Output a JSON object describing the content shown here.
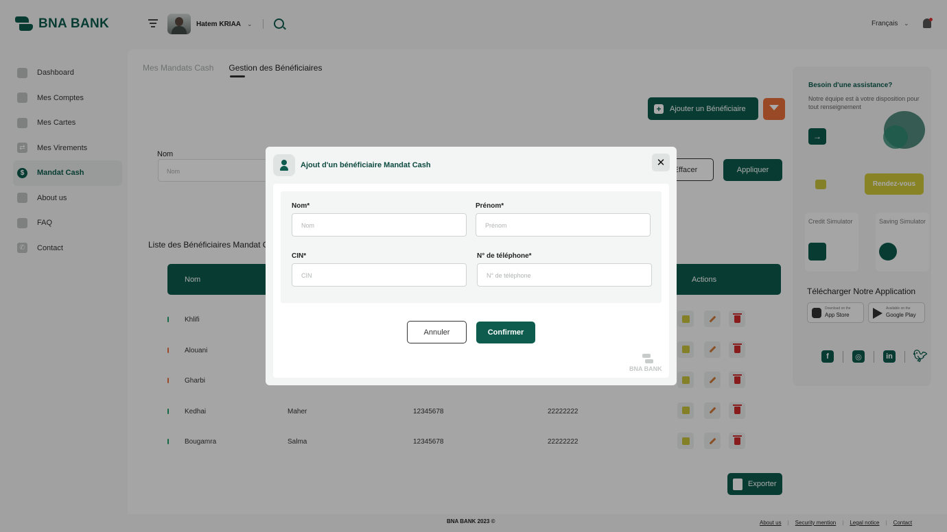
{
  "brand": {
    "name": "BNA BANK",
    "color": "#0d5c4e"
  },
  "sidebar": {
    "items": [
      {
        "label": "Dashboard",
        "icon": "dashboard-icon"
      },
      {
        "label": "Mes Comptes",
        "icon": "folder-icon"
      },
      {
        "label": "Mes Cartes",
        "icon": "card-icon"
      },
      {
        "label": "Mes Virements",
        "icon": "transfer-icon"
      },
      {
        "label": "Mandat Cash",
        "icon": "cash-icon",
        "active": true
      },
      {
        "label": "About us",
        "icon": "info-icon"
      },
      {
        "label": "FAQ",
        "icon": "faq-icon"
      },
      {
        "label": "Contact",
        "icon": "phone-icon"
      }
    ]
  },
  "topbar": {
    "user_name": "Hatem KRIAA",
    "language": "Français"
  },
  "tabs": [
    {
      "label": "Mes Mandats Cash"
    },
    {
      "label": "Gestion des Bénéficiaires",
      "active": true
    }
  ],
  "toolbar": {
    "add_label": "Ajouter un Bénéficiaire",
    "export_label": "Exporter"
  },
  "filter": {
    "label": "Nom",
    "placeholder": "Nom",
    "clear_label": "Effacer",
    "apply_label": "Appliquer"
  },
  "list": {
    "title": "Liste des Bénéficiaires Mandat Cash",
    "columns": {
      "nom": "Nom",
      "actions": "Actions"
    },
    "rows": [
      {
        "nom": "Khlifi",
        "prenom": "",
        "cin": "",
        "phone": "",
        "mark_color": "#1e9e6a"
      },
      {
        "nom": "Alouani",
        "prenom": "",
        "cin": "",
        "phone": "",
        "mark_color": "#e8703a"
      },
      {
        "nom": "Gharbi",
        "prenom": "",
        "cin": "",
        "phone": "",
        "mark_color": "#e8703a"
      },
      {
        "nom": "Kedhai",
        "prenom": "Maher",
        "cin": "12345678",
        "phone": "22222222",
        "mark_color": "#1e9e6a"
      },
      {
        "nom": "Bougamra",
        "prenom": "Salma",
        "cin": "12345678",
        "phone": "22222222",
        "mark_color": "#1e9e6a"
      }
    ]
  },
  "right_panel": {
    "assist_title": "Besoin d'une assistance?",
    "assist_text": "Notre équipe est à votre disposition pour tout renseignement",
    "rdv_label": "Rendez-vous",
    "credit_sim": "Credit Simulator",
    "saving_sim": "Saving Simulator",
    "download_title": "Télécharger Notre Application",
    "app_store_small": "Download on the",
    "app_store": "App Store",
    "play_small": "Available on the",
    "play_store": "Google Play",
    "social": [
      "facebook-icon",
      "instagram-icon",
      "linkedin-icon",
      "twitter-icon"
    ]
  },
  "footer": {
    "copyright": "BNA BANK 2023 ©",
    "links": [
      "About us",
      "Security mention",
      "Legal notice",
      "Contact"
    ]
  },
  "modal": {
    "title": "Ajout d'un bénéficiaire Mandat Cash",
    "fields": {
      "nom": {
        "label": "Nom*",
        "placeholder": "Nom"
      },
      "prenom": {
        "label": "Prénom*",
        "placeholder": "Prénom"
      },
      "cin": {
        "label": "CIN*",
        "placeholder": "CIN"
      },
      "phone": {
        "label": "N° de téléphone*",
        "placeholder": "N° de téléphone"
      }
    },
    "cancel_label": "Annuler",
    "confirm_label": "Confirmer",
    "watermark": "BNA BANK"
  }
}
